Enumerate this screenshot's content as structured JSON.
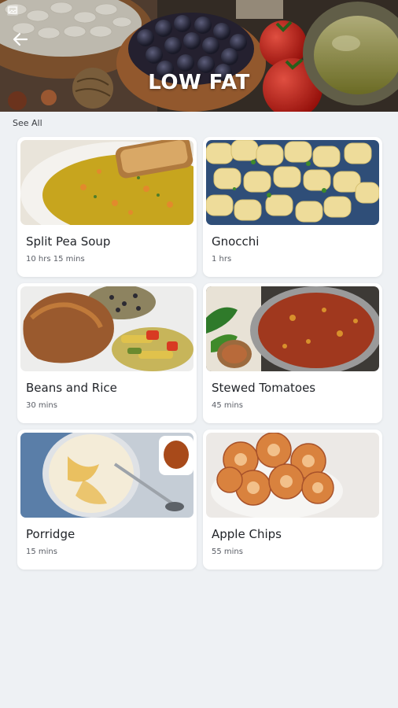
{
  "header": {
    "title": "LOW FAT",
    "back_icon": "arrow-left-icon"
  },
  "see_all_label": "See All",
  "recipes": [
    {
      "name": "Split Pea Soup",
      "time": "10 hrs 15 mins"
    },
    {
      "name": "Gnocchi",
      "time": "1 hrs"
    },
    {
      "name": "Beans and Rice",
      "time": "30 mins"
    },
    {
      "name": "Stewed Tomatoes",
      "time": "45 mins"
    },
    {
      "name": "Porridge",
      "time": "15 mins"
    },
    {
      "name": "Apple Chips",
      "time": "55 mins"
    }
  ],
  "colors": {
    "background": "#eef1f4",
    "card": "#ffffff",
    "title_text": "#22252a",
    "sub_text": "#5a5e66"
  }
}
